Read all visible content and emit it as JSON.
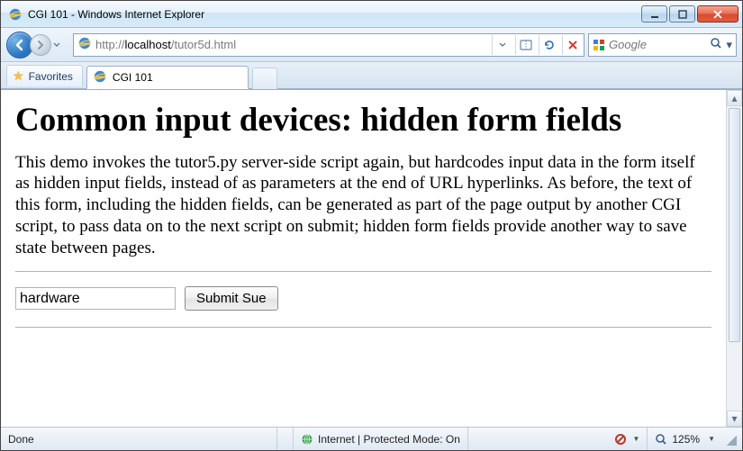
{
  "window": {
    "title": "CGI 101 - Windows Internet Explorer"
  },
  "nav": {
    "url_prefix": "http://",
    "url_host": "localhost",
    "url_path": "/tutor5d.html"
  },
  "search": {
    "placeholder": "Google"
  },
  "favorites": {
    "label": "Favorites"
  },
  "tab": {
    "title": "CGI 101"
  },
  "page": {
    "heading": "Common input devices: hidden form fields",
    "paragraph": "This demo invokes the tutor5.py server-side script again, but hardcodes input data in the form itself as hidden input fields, instead of as parameters at the end of URL hyperlinks. As before, the text of this form, including the hidden fields, can be generated as part of the page output by another CGI script, to pass data on to the next script on submit; hidden form fields provide another way to save state between pages.",
    "input_value": "hardware",
    "submit_label": "Submit Sue"
  },
  "status": {
    "left": "Done",
    "zone": "Internet | Protected Mode: On",
    "zoom": "125%"
  }
}
